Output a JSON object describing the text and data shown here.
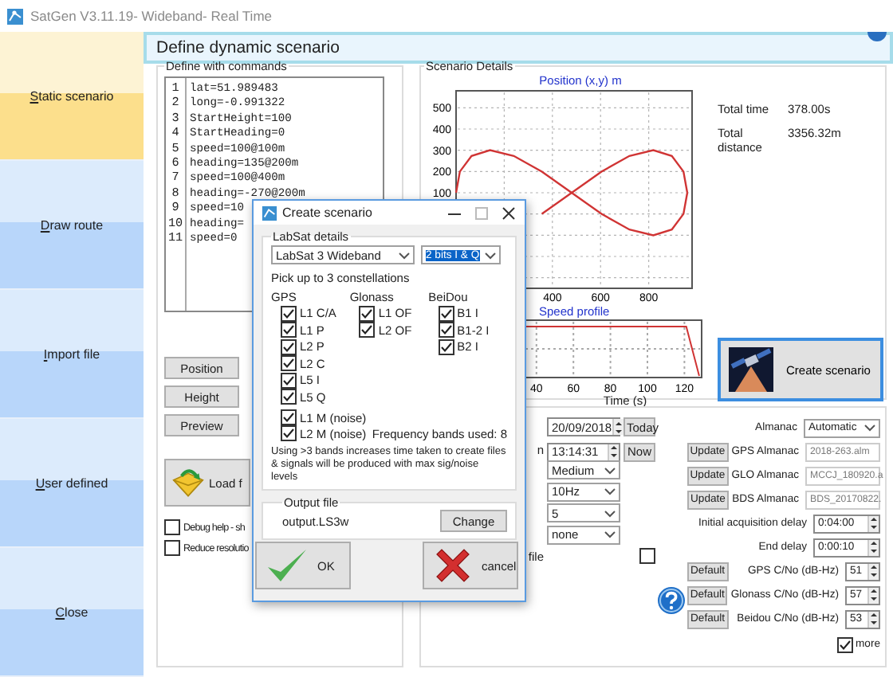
{
  "window": {
    "title": "SatGen V3.11.19- Wideband- Real Time"
  },
  "sidebar": {
    "items": [
      {
        "label": "Static scenario",
        "selected": true
      },
      {
        "label": "Draw route",
        "selected": false
      },
      {
        "label": "Import file",
        "selected": false
      },
      {
        "label": "User defined",
        "selected": false
      },
      {
        "label": "Close",
        "selected": false
      }
    ]
  },
  "header": {
    "title": "Define dynamic scenario"
  },
  "commands": {
    "title": "Define with commands",
    "lines": [
      {
        "number": "1",
        "text": "lat=51.989483"
      },
      {
        "number": "2",
        "text": "long=-0.991322"
      },
      {
        "number": "3",
        "text": "StartHeight=100"
      },
      {
        "number": "4",
        "text": "StartHeading=0"
      },
      {
        "number": "5",
        "text": "speed=100@100m"
      },
      {
        "number": "6",
        "text": "heading=135@200m"
      },
      {
        "number": "7",
        "text": "speed=100@400m"
      },
      {
        "number": "8",
        "text": "heading=-270@200m"
      },
      {
        "number": "9",
        "text": "speed=10"
      },
      {
        "number": "10",
        "text": "heading="
      },
      {
        "number": "11",
        "text": "speed=0"
      }
    ],
    "buttons": [
      "Position",
      "Height",
      "Preview"
    ],
    "load_button": "Load f",
    "options": [
      {
        "label": "Debug help - sh",
        "checked": false
      },
      {
        "label": "Reduce resolutio",
        "checked": false
      }
    ]
  },
  "scenario_details": {
    "title": "Scenario Details",
    "position_chart": {
      "chart_data": {
        "type": "line",
        "title": "Position (x,y) m",
        "x": [
          960,
          944,
          896,
          819,
          720,
          604,
          480,
          356,
          null,
          null,
          null,
          null,
          0,
          16,
          64,
          141,
          240,
          356,
          480,
          604,
          720,
          819,
          896,
          944,
          960
        ],
        "series": [
          {
            "color": "#d03434",
            "values": [
              100,
              200,
              273,
              300,
              273,
              200,
              100,
              0,
              null,
              null,
              null,
              null,
              100,
              200,
              273,
              300,
              273,
              200,
              100,
              0,
              -73,
              -100,
              -73,
              0,
              100
            ]
          }
        ],
        "grid": true,
        "xlim": [
          0,
          980
        ],
        "ylim": [
          -350,
          580
        ],
        "xticks": [
          400,
          600,
          800
        ],
        "yticks": [
          100,
          200,
          300,
          400,
          500
        ]
      }
    },
    "speed_profile": {
      "title": "Speed profile",
      "xlabel": "Time (s)",
      "xticks": [
        "40",
        "60",
        "80",
        "100",
        "120"
      ]
    },
    "stats": [
      {
        "label": "Total time",
        "value": "378.00s"
      },
      {
        "label": "Total distance",
        "value": "3356.32m"
      }
    ],
    "create_button": "Create scenario"
  },
  "settings": {
    "date": "20/09/2018",
    "today_button": "Today",
    "time_label": "n",
    "time": "13:14:31",
    "now_button": "Now",
    "dropdowns": [
      "Medium",
      "10Hz",
      "5",
      "none"
    ],
    "file_option": {
      "label": "file",
      "checked": false
    },
    "almanac": {
      "label": "Almanac",
      "value": "Automatic"
    },
    "almanac_files": [
      {
        "button": "Update",
        "label": "GPS Almanac",
        "value": "2018-263.alm"
      },
      {
        "button": "Update",
        "label": "GLO Almanac",
        "value": "MCCJ_180920.a"
      },
      {
        "button": "Update",
        "label": "BDS Almanac",
        "value": "BDS_20170822."
      }
    ],
    "delays": [
      {
        "label": "Initial acquisition delay",
        "value": "0:04:00"
      },
      {
        "label": "End delay",
        "value": "0:00:10"
      }
    ],
    "cno": [
      {
        "button": "Default",
        "label": "GPS C/No (dB-Hz)",
        "value": "51"
      },
      {
        "button": "Default",
        "label": "Glonass C/No (dB-Hz)",
        "value": "57"
      },
      {
        "button": "Default",
        "label": "Beidou C/No (dB-Hz)",
        "value": "53"
      }
    ],
    "more": {
      "label": "more",
      "checked": true
    }
  },
  "dialog": {
    "title": "Create scenario",
    "labsat_title": "LabSat details",
    "device": "LabSat 3 Wideband",
    "bits": "2 bits I & Q",
    "pick_label": "Pick up to 3 constellations",
    "constellations": [
      {
        "name": "GPS",
        "signals": [
          {
            "label": "L1 C/A",
            "checked": true
          },
          {
            "label": "L1 P",
            "checked": true
          },
          {
            "label": "L2 P",
            "checked": true
          },
          {
            "label": "L2 C",
            "checked": true
          },
          {
            "label": "L5 I",
            "checked": true
          },
          {
            "label": "L5 Q",
            "checked": true
          }
        ]
      },
      {
        "name": "Glonass",
        "signals": [
          {
            "label": "L1 OF",
            "checked": true
          },
          {
            "label": "L2 OF",
            "checked": true
          }
        ]
      },
      {
        "name": "BeiDou",
        "signals": [
          {
            "label": "B1 I",
            "checked": true
          },
          {
            "label": "B1-2 I",
            "checked": true
          },
          {
            "label": "B2 I",
            "checked": true
          }
        ]
      }
    ],
    "noise": [
      {
        "label": "L1 M (noise)",
        "checked": true
      },
      {
        "label": "L2 M (noise)",
        "checked": true
      }
    ],
    "bands_used": "Frequency bands used: 8",
    "note": "Using >3 bands increases time taken to create files & signals will be produced with max sig/noise levels",
    "output_title": "Output file",
    "output_file": "output.LS3w",
    "change_button": "Change",
    "ok_button": "OK",
    "cancel_button": "cancel"
  }
}
